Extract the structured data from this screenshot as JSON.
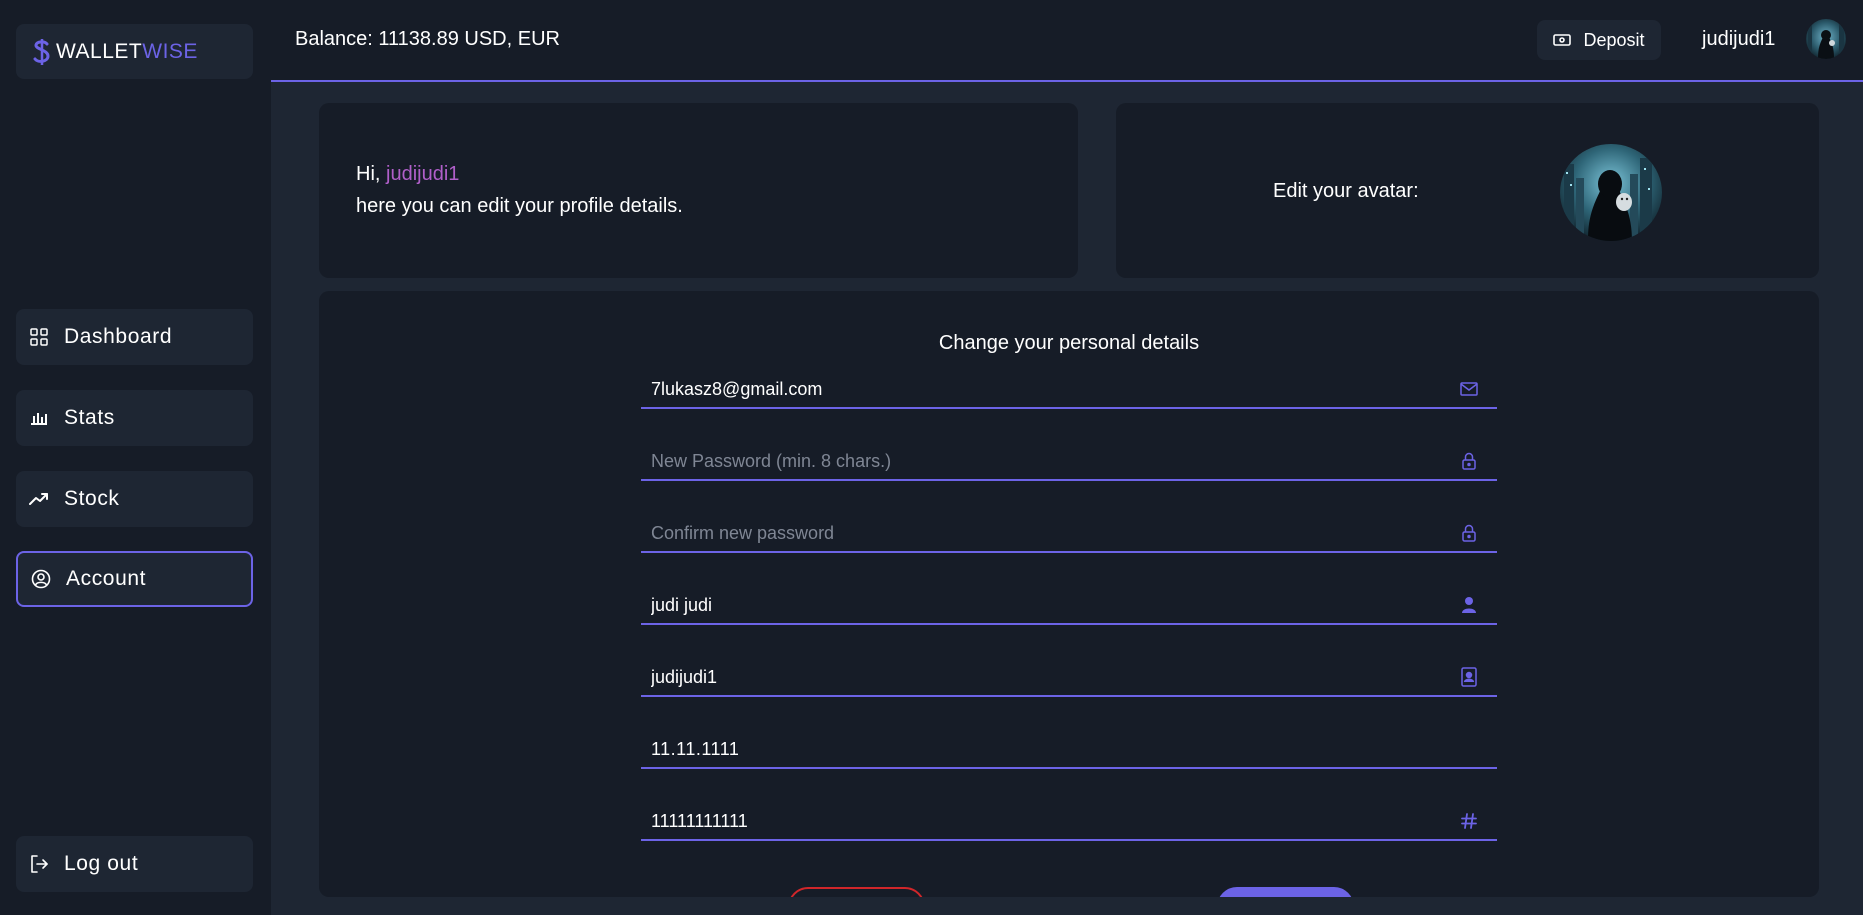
{
  "brand": {
    "part1": "WALLET",
    "part2": "WISE"
  },
  "sidebar": {
    "items": [
      {
        "label": "Dashboard",
        "icon": "grid-icon"
      },
      {
        "label": "Stats",
        "icon": "bar-chart-icon"
      },
      {
        "label": "Stock",
        "icon": "trending-up-icon"
      },
      {
        "label": "Account",
        "icon": "user-circle-icon",
        "active": true
      }
    ],
    "logout": {
      "label": "Log out",
      "icon": "logout-icon"
    }
  },
  "header": {
    "balance": "Balance: 11138.89 USD, EUR",
    "deposit_label": "Deposit",
    "username": "judijudi1"
  },
  "greeting": {
    "hi": "Hi, ",
    "username": "judijudi1",
    "subtitle": "here you can edit your profile details."
  },
  "avatar_card": {
    "label": "Edit your avatar:"
  },
  "form": {
    "title": "Change your personal details",
    "fields": [
      {
        "name": "email",
        "value": "7lukasz8@gmail.com",
        "placeholder": "",
        "icon": "mail-icon"
      },
      {
        "name": "new-password",
        "value": "",
        "placeholder": "New Password (min. 8 chars.)",
        "icon": "lock-icon"
      },
      {
        "name": "confirm-password",
        "value": "",
        "placeholder": "Confirm new password",
        "icon": "lock-icon"
      },
      {
        "name": "full-name",
        "value": "judi judi",
        "placeholder": "",
        "icon": "person-icon"
      },
      {
        "name": "username",
        "value": "judijudi1",
        "placeholder": "",
        "icon": "contact-book-icon"
      },
      {
        "name": "birth-date",
        "value": "11.11.1111",
        "placeholder": "",
        "icon": ""
      },
      {
        "name": "phone",
        "value": "11111111111",
        "placeholder": "",
        "icon": "hash-icon"
      }
    ]
  },
  "colors": {
    "accent": "#6c63e6",
    "sidebar_bg": "#161c27",
    "page_bg": "#1e2633",
    "username_highlight": "#b05fc9",
    "cancel_border": "#d0262a"
  }
}
